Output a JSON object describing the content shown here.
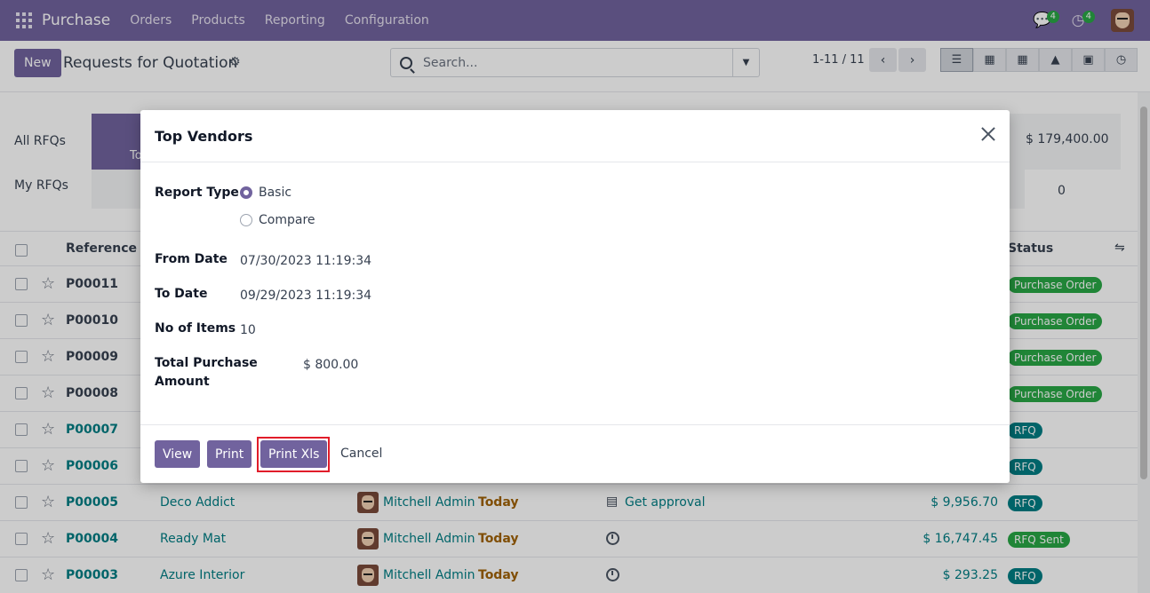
{
  "nav": {
    "app_name": "Purchase",
    "items": [
      "Orders",
      "Products",
      "Reporting",
      "Configuration"
    ],
    "chat_badge": "4",
    "activity_badge": "4"
  },
  "control": {
    "new_label": "New",
    "title": "Requests for Quotation",
    "search_placeholder": "Search...",
    "pager": "1-11 / 11"
  },
  "dashboard": {
    "all_rfqs": "All RFQs",
    "my_rfqs": "My RFQs",
    "tile_text": "To",
    "total_value": "$ 179,400.00",
    "my_value": "0"
  },
  "list": {
    "col_reference": "Reference",
    "col_status": "Status",
    "rows": [
      {
        "ref": "P00011",
        "status": "Purchase Order",
        "status_kind": "po"
      },
      {
        "ref": "P00010",
        "status": "Purchase Order",
        "status_kind": "po"
      },
      {
        "ref": "P00009",
        "status": "Purchase Order",
        "status_kind": "po"
      },
      {
        "ref": "P00008",
        "status": "Purchase Order",
        "status_kind": "po"
      },
      {
        "ref": "P00007",
        "status": "RFQ",
        "status_kind": "rfq"
      },
      {
        "ref": "P00006",
        "status": "RFQ",
        "status_kind": "rfq"
      },
      {
        "ref": "P00005",
        "vendor": "Deco Addict",
        "buyer": "Mitchell Admin",
        "deadline": "Today",
        "activity": "Get approval",
        "amount": "$ 9,956.70",
        "status": "RFQ",
        "status_kind": "rfq"
      },
      {
        "ref": "P00004",
        "vendor": "Ready Mat",
        "buyer": "Mitchell Admin",
        "deadline": "Today",
        "amount": "$ 16,747.45",
        "status": "RFQ Sent",
        "status_kind": "sent"
      },
      {
        "ref": "P00003",
        "vendor": "Azure Interior",
        "buyer": "Mitchell Admin",
        "deadline": "Today",
        "amount": "$ 293.25",
        "status": "RFQ",
        "status_kind": "rfq"
      }
    ]
  },
  "modal": {
    "title": "Top Vendors",
    "report_type_label": "Report Type",
    "option_basic": "Basic",
    "option_compare": "Compare",
    "from_date_label": "From Date",
    "from_date": "07/30/2023 11:19:34",
    "to_date_label": "To Date",
    "to_date": "09/29/2023 11:19:34",
    "items_label": "No of Items",
    "items": "10",
    "total_label_1": "Total Purchase",
    "total_label_2": "Amount",
    "total": "$ 800.00",
    "btn_view": "View",
    "btn_print": "Print",
    "btn_print_xls": "Print Xls",
    "btn_cancel": "Cancel"
  },
  "colors": {
    "brand": "#71639e",
    "link": "#017e84",
    "success": "#28a745",
    "highlight": "#e11d2a"
  }
}
